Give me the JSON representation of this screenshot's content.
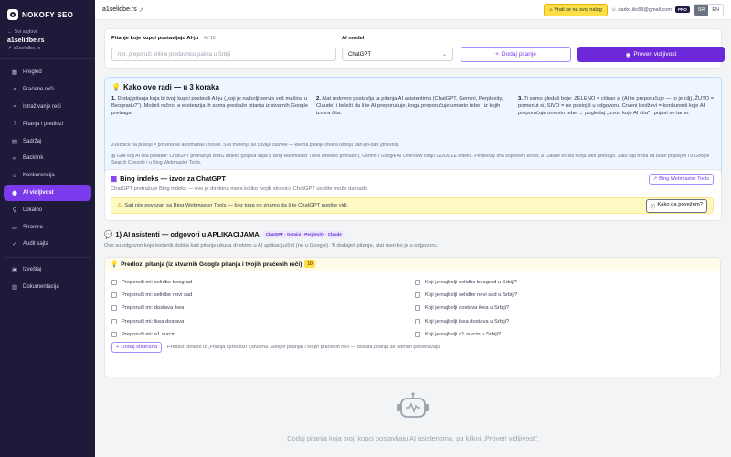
{
  "sidebar": {
    "logo": "NOKOFY SEO",
    "back": "Svi sajtovi",
    "site_name": "a1selidbe.rs",
    "site_url": "a1selidbe.rs",
    "items": [
      {
        "label": "Pregled",
        "icon": "grid-icon"
      },
      {
        "label": "Praćene reči",
        "icon": "search-icon"
      },
      {
        "label": "Istraživanje reči",
        "icon": "search-icon"
      },
      {
        "label": "Pitanja i predlozi",
        "icon": "question-icon"
      },
      {
        "label": "Sadržaj",
        "icon": "document-icon"
      },
      {
        "label": "Backlink",
        "icon": "link-icon"
      },
      {
        "label": "Konkurencija",
        "icon": "users-icon"
      },
      {
        "label": "AI vidljivost",
        "icon": "robot-icon"
      },
      {
        "label": "Lokalno",
        "icon": "pin-icon"
      },
      {
        "label": "Stranice",
        "icon": "pages-icon"
      },
      {
        "label": "Audit sajta",
        "icon": "audit-icon"
      }
    ],
    "bottom_items": [
      {
        "label": "Izveštaj",
        "icon": "report-icon"
      },
      {
        "label": "Dokumentacija",
        "icon": "book-icon"
      }
    ]
  },
  "topbar": {
    "site": "a1selidbe.rs",
    "return_label": "Vrati se na svoj nalog",
    "email": "darko.ilic83@gmail.com",
    "plan": "PRO",
    "lang_sr": "SR",
    "lang_en": "EN"
  },
  "form": {
    "question_label": "Pitanje koje kupci postavljaju AI-ju",
    "counter": "0 / 15",
    "question_placeholder": "npr. preporuči online prodavnicu patika u Srbiji",
    "model_label": "AI model",
    "model_value": "ChatGPT",
    "add_button": "Dodaj pitanje",
    "check_button": "Proveri vidljivost"
  },
  "how": {
    "title": "Kako ovo radi — u 3 koraka",
    "step1_num": "1.",
    "step1": "Dodaj pitanja koja bi tvoji kupci postavili AI-ju („koji je najbolji servis veš mašina u Beogradu?\"). Možeš ručno, a ekstenzija ih sama predlaže pitanja iz stvarnih Google pretraga.",
    "step2_num": "2.",
    "step2": "Alat redovno postavlja ta pitanja AI asistentima (ChatGPT, Gemini, Perplexity, Claude) i beleži da li te AI preporučuje, koga preporučuje umesto tebe i iz kojih izvora čita.",
    "step3_num": "3.",
    "step3": "Ti samo gledaš boje: ZELENO = citiran si (AI te preporučuje — to je cilj), ŽUTO = pomenut si, SIVO = ne postojiš u odgovoru. Crveni bedževi = konkurenti koje AI preporučuje umesto tebe → pogledaj „Izvori koje AI čita\" i pojavi se tamo.",
    "note1": "Zvezdice na pitanju = provera se automatski i češće. Sva merenja se čuvaju zauvek — klik na pitanje otvara istoriju dan-po-dan (dnevno).",
    "note2": "Gde koji AI čita podatke: ChatGPT pretražuje BING indeks (pojava sajta u Bing Webmaster Tools direktno pomaže!). Gemini i Google AI Overview čitaju GOOGLE indeks. Perplexity ima sopstveni kroler, a Claude koristi svoju web pretragu. Zato sajt treba da bude prijavljen i u Google Search Console i u Bing Webmaster Tools."
  },
  "bing": {
    "title": "Bing indeks — izvor za ChatGPT",
    "tools_button": "Bing Webmaster Tools",
    "desc": "ChatGPT pretražuje Bing indeks — ovo je direktna mera koliko tvojih stranica ChatGPT uopšte može da nađe.",
    "warning": "Sajt nije povezan sa Bing Webmaster Tools — bez toga ne znamo da li te ChatGPT uopšte vidi.",
    "how_button": "Kako da povežem?"
  },
  "assistants": {
    "title": "1) AI asistenti — odgovori u APLIKACIJAMA",
    "chips": "ChatGPT · Gemini · Perplexity · Claude",
    "desc": "Ovo su odgovori koje korisnik dobija kad pitanje ukuca direktno u AI aplikaciju/čet (ne u Google). Ti dodaješ pitanja, alat meri ko je u odgovoru.",
    "suggest_title": "Predlozi pitanja (iz stvarnih Google pitanja i tvojih praćenih reči)",
    "suggest_count": "10",
    "left": [
      "Preporuči mi: selidbe beograd",
      "Preporuči mi: selidbe novi sad",
      "Preporuči mi: dostava ikea",
      "Preporuči mi: ikea dostava",
      "Preporuči mi: a1 surcin"
    ],
    "right": [
      "Koji je najbolji selidbe beograd u Srbiji?",
      "Koji je najbolji selidbe novi sad u Srbiji?",
      "Koji je najbolji dostava ikea u Srbiji?",
      "Koji je najbolji ikea dostava u Srbiji?",
      "Koji je najbolji a1 surcin u Srbiji?"
    ],
    "add_selected": "Dodaj štiklirana",
    "footer": "Predlozi dolaze iz „Pitanja i predlozi\" (stvarna Google pitanja) i tvojih praćenih reči — dodata pitanja se odmah proveravaju."
  },
  "empty": {
    "text": "Dodaj pitanja koja tvoji kupci postavljaju AI asistentima, pa klikni „Proveri vidljivost\"."
  }
}
